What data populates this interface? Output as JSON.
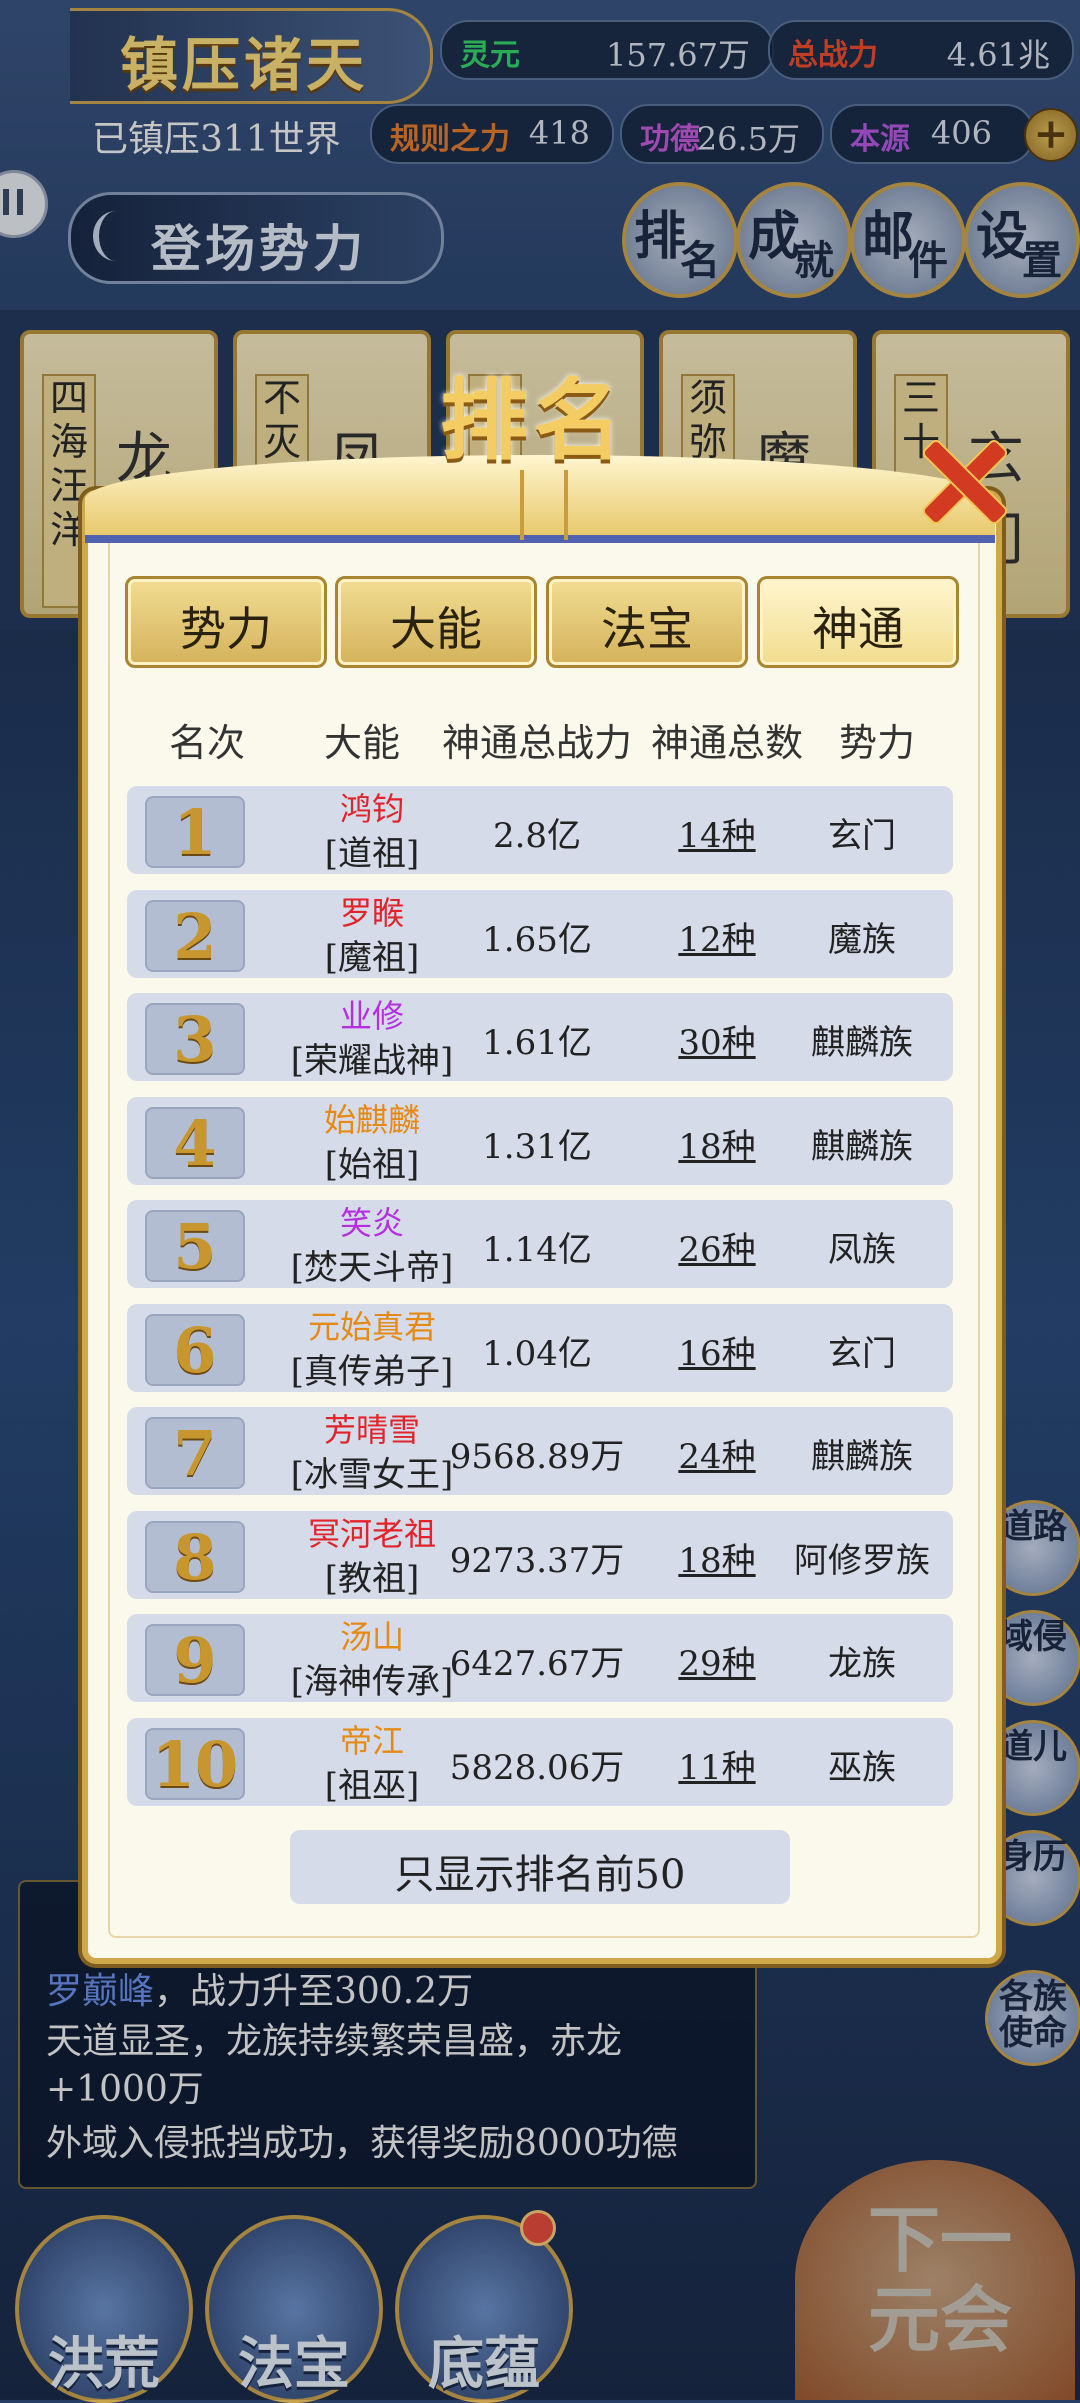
{
  "hud": {
    "title": "镇压诸天",
    "subtitle": "已镇压311世界",
    "resources": [
      {
        "label": "灵元",
        "value": "157.67万",
        "color": "#34d36a"
      },
      {
        "label": "总战力",
        "value": "4.61兆",
        "color": "#e84b2e"
      },
      {
        "label": "规则之力",
        "value": "418",
        "color": "#e07a2e"
      },
      {
        "label": "功德",
        "value": "26.5万",
        "color": "#c35ad8"
      },
      {
        "label": "本源",
        "value": "406",
        "color": "#b25ae0"
      }
    ],
    "force_button": "登场势力",
    "round_buttons": [
      {
        "a": "排",
        "b": "名"
      },
      {
        "a": "成",
        "b": "就"
      },
      {
        "a": "邮",
        "b": "件"
      },
      {
        "a": "设",
        "b": "置"
      }
    ]
  },
  "bg_cards": [
    {
      "vertical": "四海汪洋",
      "big": "龙"
    },
    {
      "vertical": "不灭",
      "big": "凤"
    },
    {
      "vertical": "",
      "big": ""
    },
    {
      "vertical": "须弥",
      "big": "魔"
    },
    {
      "vertical": "三十",
      "big": "玄门"
    }
  ],
  "modal": {
    "title": "排名",
    "tabs": [
      "势力",
      "大能",
      "法宝",
      "神通"
    ],
    "active_tab": "神通",
    "headers": [
      "名次",
      "大能",
      "神通总战力",
      "神通总数",
      "势力"
    ],
    "rows": [
      {
        "rank": "1",
        "name": "鸿钧",
        "name_color": "#e0242a",
        "title": "[道祖]",
        "power": "2.8亿",
        "count": "14种",
        "faction": "玄门"
      },
      {
        "rank": "2",
        "name": "罗睺",
        "name_color": "#e0242a",
        "title": "[魔祖]",
        "power": "1.65亿",
        "count": "12种",
        "faction": "魔族"
      },
      {
        "rank": "3",
        "name": "业修",
        "name_color": "#b52fe0",
        "title": "[荣耀战神]",
        "power": "1.61亿",
        "count": "30种",
        "faction": "麒麟族"
      },
      {
        "rank": "4",
        "name": "始麒麟",
        "name_color": "#e58a14",
        "title": "[始祖]",
        "power": "1.31亿",
        "count": "18种",
        "faction": "麒麟族"
      },
      {
        "rank": "5",
        "name": "笑炎",
        "name_color": "#b52fe0",
        "title": "[焚天斗帝]",
        "power": "1.14亿",
        "count": "26种",
        "faction": "凤族"
      },
      {
        "rank": "6",
        "name": "元始真君",
        "name_color": "#e58a14",
        "title": "[真传弟子]",
        "power": "1.04亿",
        "count": "16种",
        "faction": "玄门"
      },
      {
        "rank": "7",
        "name": "芳晴雪",
        "name_color": "#e0242a",
        "title": "[冰雪女王]",
        "power": "9568.89万",
        "count": "24种",
        "faction": "麒麟族"
      },
      {
        "rank": "8",
        "name": "冥河老祖",
        "name_color": "#e0242a",
        "title": "[教祖]",
        "power": "9273.37万",
        "count": "18种",
        "faction": "阿修罗族"
      },
      {
        "rank": "9",
        "name": "汤山",
        "name_color": "#e58a14",
        "title": "[海神传承]",
        "power": "6427.67万",
        "count": "29种",
        "faction": "龙族"
      },
      {
        "rank": "10",
        "name": "帝江",
        "name_color": "#e58a14",
        "title": "[祖巫]",
        "power": "5828.06万",
        "count": "11种",
        "faction": "巫族"
      }
    ],
    "footer": "只显示排名前50"
  },
  "log": {
    "line1_highlight": "罗巅峰",
    "line1_rest": "，战力升至300.2万",
    "line2": "天道显圣，龙族持续繁荣昌盛，赤龙",
    "line3": "+1000万",
    "line4": "外域入侵抵挡成功，获得奖励8000功德"
  },
  "side_icons": [
    "道路",
    "域侵",
    "道儿",
    "身历",
    "各族使命"
  ],
  "next_button": "下一元会",
  "bottom_nav": [
    "洪荒",
    "法宝",
    "底蕴"
  ]
}
